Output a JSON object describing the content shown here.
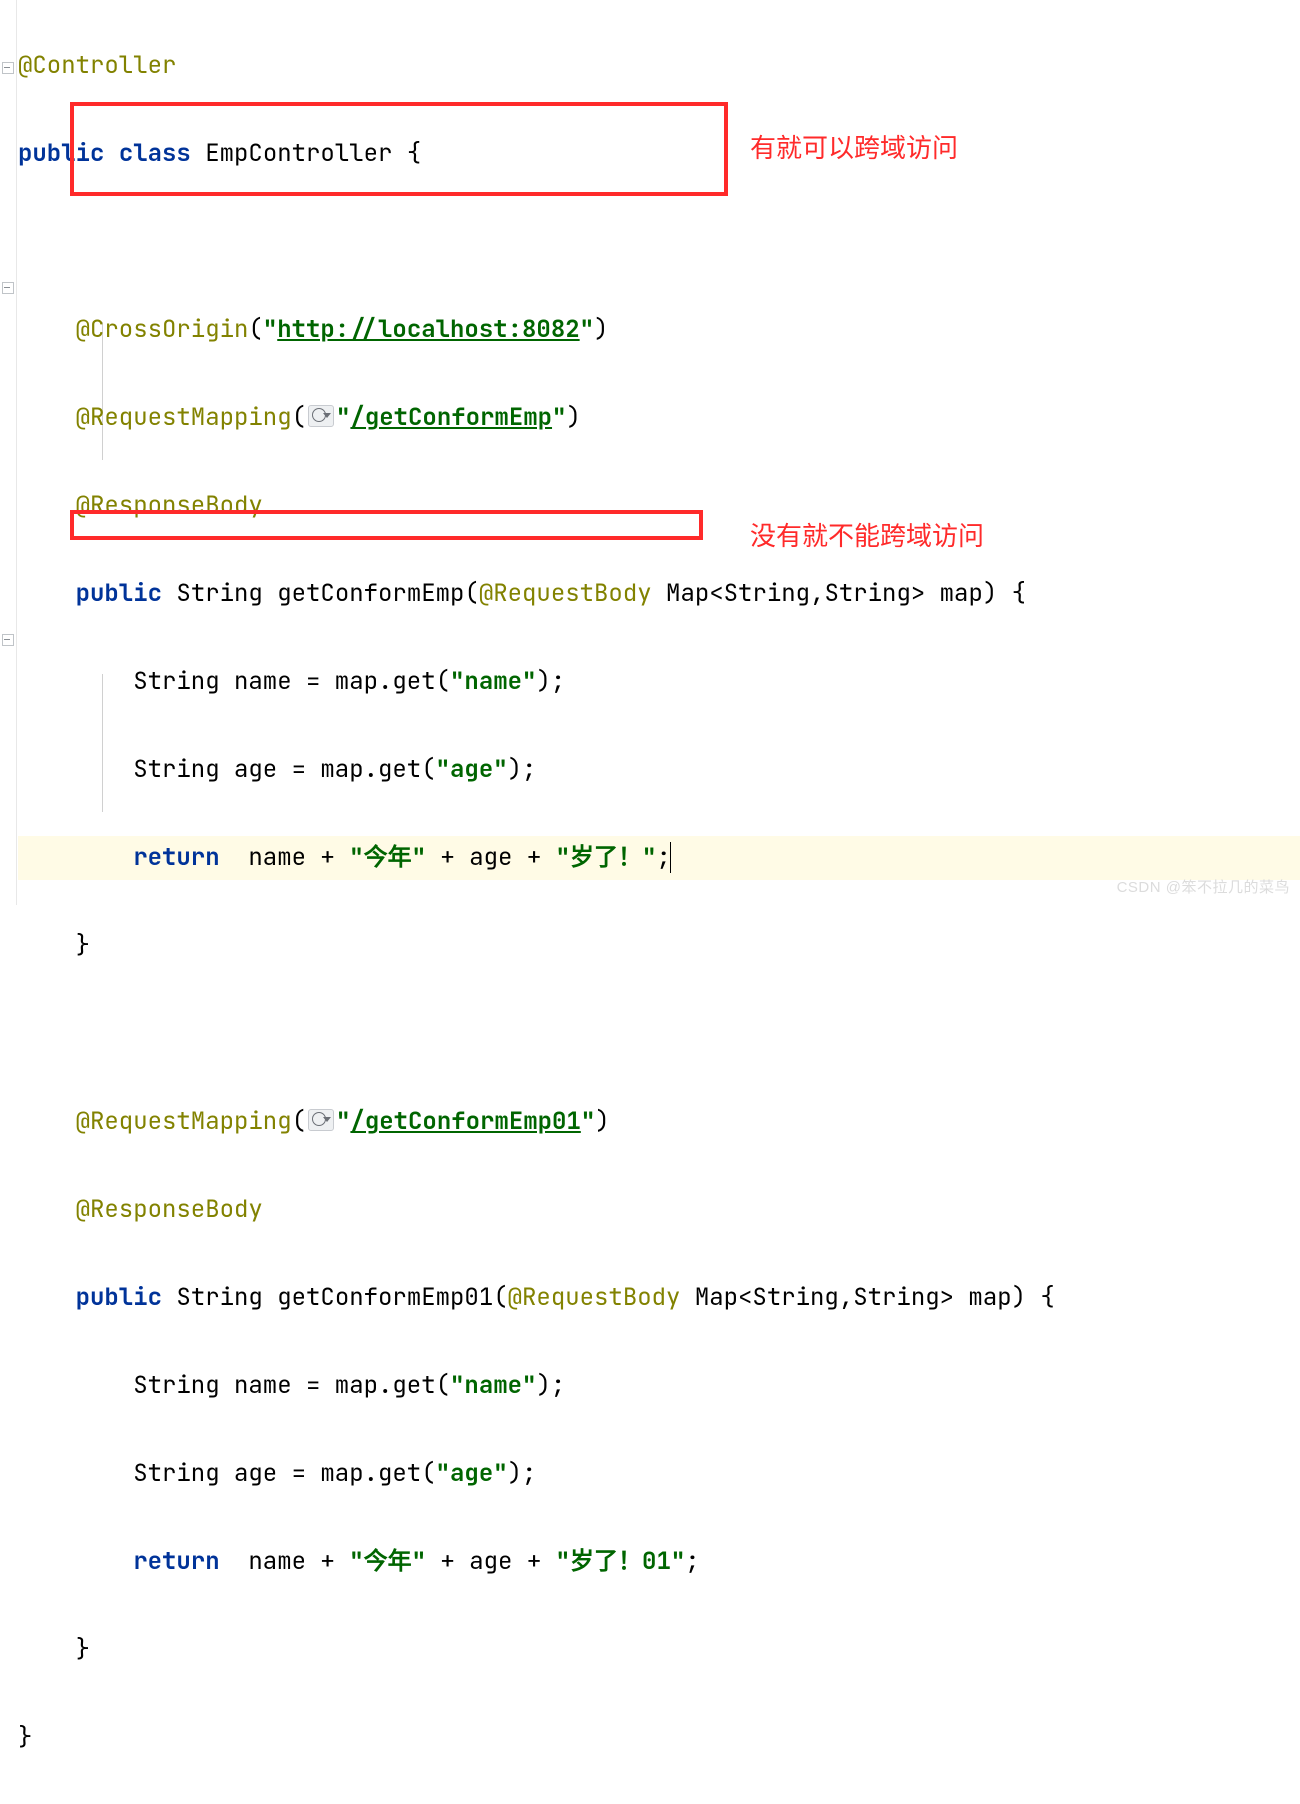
{
  "code": {
    "annController": "@Controller",
    "kwPublic": "public",
    "kwClass": "class",
    "className": "EmpController",
    "braceOpen": "{",
    "braceClose": "}",
    "crossOrigin": "@CrossOrigin",
    "crossOriginUrl": "http://localhost:8082",
    "requestMapping": "@RequestMapping",
    "mapping1": "/getConformEmp",
    "mapping2": "/getConformEmp01",
    "responseBody": "@ResponseBody",
    "methodSig1a": " String getConformEmp(",
    "methodSig2a": " String getConformEmp01(",
    "requestBody": "@RequestBody",
    "mapParam": " Map<String,String> map) {",
    "body1a": "String name = map.get(",
    "nameKey": "name",
    "body1b": ");",
    "body2a": "String age = map.get(",
    "ageKey": "age",
    "body2b": ");",
    "kwReturn": "return",
    "retA": "  name + ",
    "str1": "今年",
    "retB": " + age + ",
    "str2": "岁了！",
    "str2b": "岁了！01",
    "semicolon": ";"
  },
  "annotations": {
    "hasCrossOrigin": "有就可以跨域访问",
    "noCrossOrigin": "没有就不能跨域访问"
  },
  "watermark": "CSDN @笨不拉几的菜鸟",
  "colors": {
    "keyword": "#003399",
    "annotation": "#828200",
    "string": "#006500",
    "highlight_bg": "#fffbe6",
    "red": "#ff2a2a"
  }
}
